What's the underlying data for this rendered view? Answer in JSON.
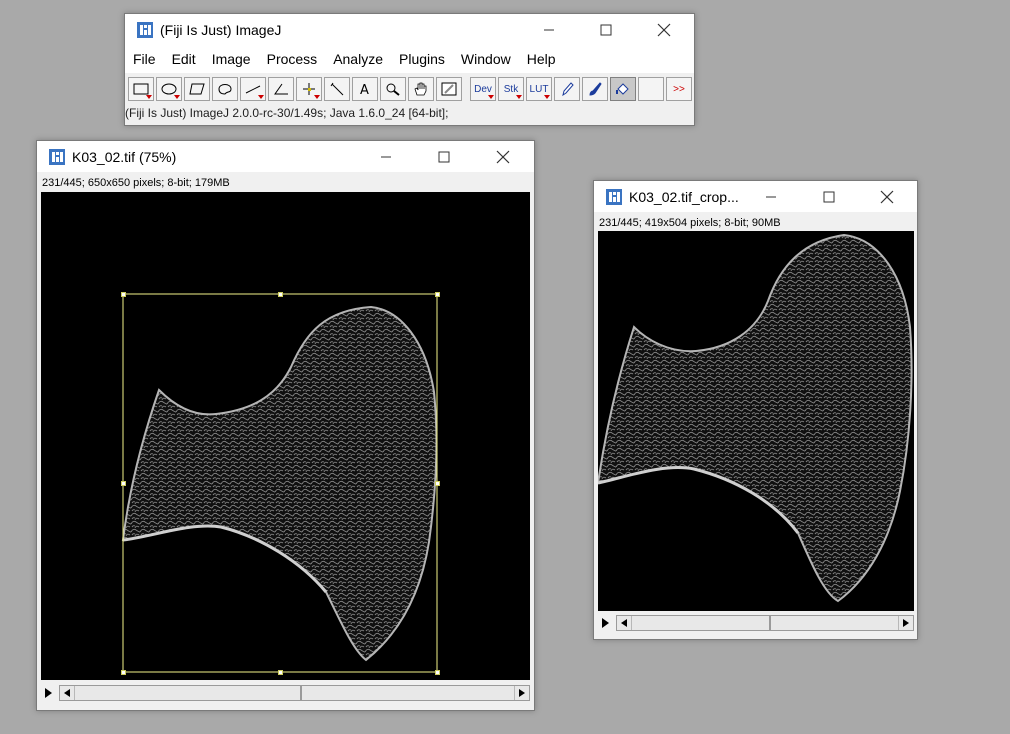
{
  "main_window": {
    "title": "(Fiji Is Just) ImageJ",
    "menus": [
      "File",
      "Edit",
      "Image",
      "Process",
      "Analyze",
      "Plugins",
      "Window",
      "Help"
    ],
    "tool_labels": {
      "dev": "Dev",
      "stk": "Stk",
      "lut": "LUT",
      "more": ">>"
    },
    "status": "(Fiji Is Just) ImageJ 2.0.0-rc-30/1.49s; Java 1.6.0_24 [64-bit];"
  },
  "image_window_1": {
    "title": "K03_02.tif (75%)",
    "info": "231/445; 650x650 pixels; 8-bit; 179MB",
    "scroll_position": 0.52
  },
  "image_window_2": {
    "title": "K03_02.tif_crop...",
    "info": "231/445; 419x504 pixels; 8-bit; 90MB",
    "scroll_position": 0.52
  },
  "colors": {
    "desktop": "#a9a9a9",
    "selection": "#f4f48a",
    "bone": "#9a9a9a"
  }
}
